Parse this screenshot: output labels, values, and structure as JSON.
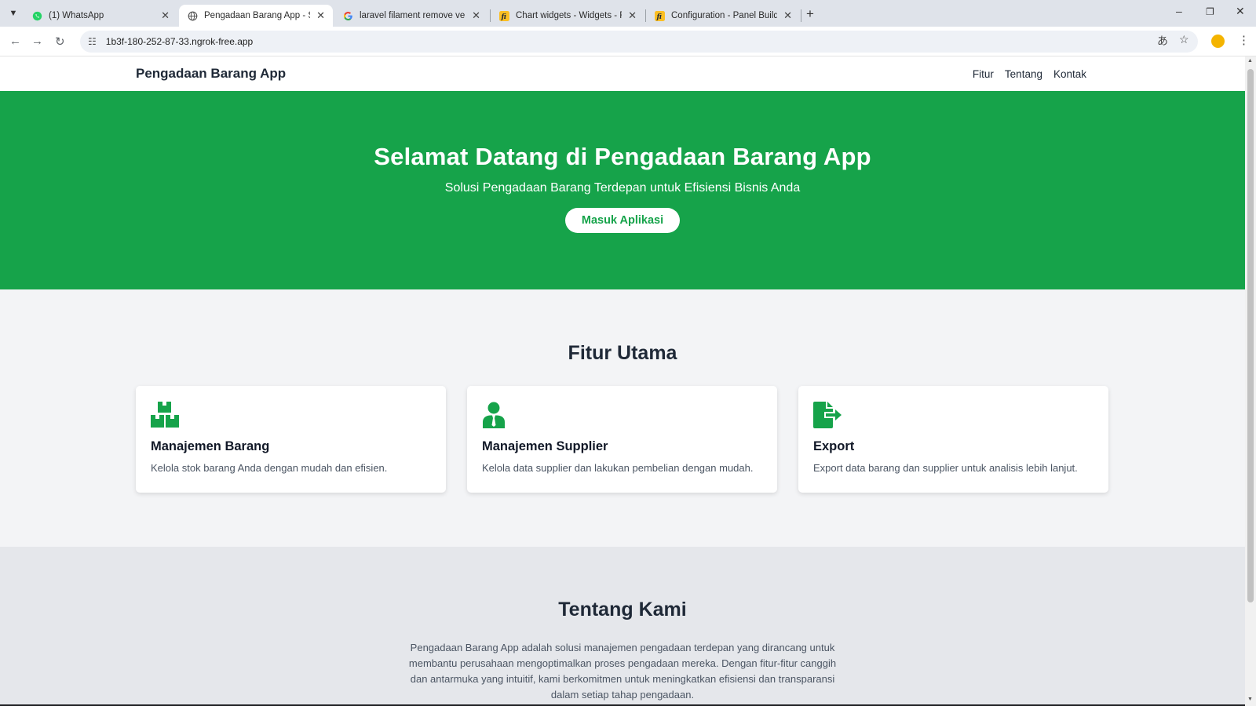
{
  "browser": {
    "tabs": [
      {
        "title": "(1) WhatsApp",
        "favicon": "whatsapp-icon",
        "active": false
      },
      {
        "title": "Pengadaan Barang App - Solusi",
        "favicon": "globe-icon",
        "active": true
      },
      {
        "title": "laravel filament remove version",
        "favicon": "google-icon",
        "active": false
      },
      {
        "title": "Chart widgets - Widgets - Filan",
        "favicon": "filament-icon",
        "active": false
      },
      {
        "title": "Configuration - Panel Builder -",
        "favicon": "filament-icon",
        "active": false
      }
    ],
    "url": "1b3f-180-252-87-33.ngrok-free.app"
  },
  "site": {
    "brand": "Pengadaan Barang App",
    "nav": [
      "Fitur",
      "Tentang",
      "Kontak"
    ],
    "hero": {
      "title": "Selamat Datang di Pengadaan Barang App",
      "subtitle": "Solusi Pengadaan Barang Terdepan untuk Efisiensi Bisnis Anda",
      "cta": "Masuk Aplikasi"
    },
    "features": {
      "title": "Fitur Utama",
      "cards": [
        {
          "icon": "boxes-icon",
          "title": "Manajemen Barang",
          "desc": "Kelola stok barang Anda dengan mudah dan efisien."
        },
        {
          "icon": "user-tie-icon",
          "title": "Manajemen Supplier",
          "desc": "Kelola data supplier dan lakukan pembelian dengan mudah."
        },
        {
          "icon": "file-export-icon",
          "title": "Export",
          "desc": "Export data barang dan supplier untuk analisis lebih lanjut."
        }
      ]
    },
    "about": {
      "title": "Tentang Kami",
      "text": "Pengadaan Barang App adalah solusi manajemen pengadaan terdepan yang dirancang untuk membantu perusahaan mengoptimalkan proses pengadaan mereka. Dengan fitur-fitur canggih dan antarmuka yang intuitif, kami berkomitmen untuk meningkatkan efisiensi dan transparansi dalam setiap tahap pengadaan."
    }
  },
  "colors": {
    "brand_green": "#16a34a",
    "tab_strip": "#dfe3ea",
    "page_bg": "#f3f4f6",
    "about_bg": "#e5e7eb"
  }
}
